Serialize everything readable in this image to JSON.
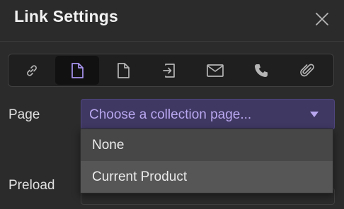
{
  "header": {
    "title": "Link Settings"
  },
  "toolbar": {
    "buttons": [
      {
        "icon": "link-icon",
        "active": false
      },
      {
        "icon": "page-icon",
        "active": true
      },
      {
        "icon": "page-outline-icon",
        "active": false
      },
      {
        "icon": "login-icon",
        "active": false
      },
      {
        "icon": "mail-icon",
        "active": false
      },
      {
        "icon": "phone-icon",
        "active": false
      },
      {
        "icon": "paperclip-icon",
        "active": false
      }
    ]
  },
  "page_field": {
    "label": "Page",
    "placeholder": "Choose a collection page...",
    "options": [
      "None",
      "Current Product"
    ],
    "hovered_option": "Current Product"
  },
  "preload_field": {
    "label": "Preload"
  },
  "colors": {
    "accent": "#b9a7f0",
    "select_bg": "#3f3862",
    "panel_bg": "#2b2b2b"
  }
}
